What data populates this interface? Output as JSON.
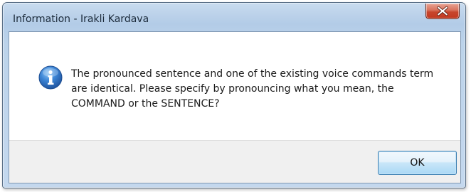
{
  "window": {
    "title": "Information - Irakli Kardava"
  },
  "title_bar": {
    "close_icon": "close-icon"
  },
  "dialog": {
    "icon": "info-icon",
    "message": "The pronounced sentence and one of the existing voice commands term are identical. Please specify by pronouncing what you mean, the COMMAND or the SENTENCE?"
  },
  "buttons": {
    "ok_label": "OK"
  },
  "colors": {
    "frame": "#bcd2ea",
    "close_button": "#c7452c",
    "info_icon": "#2a6fc0",
    "ok_button_border": "#3c7fb1"
  }
}
